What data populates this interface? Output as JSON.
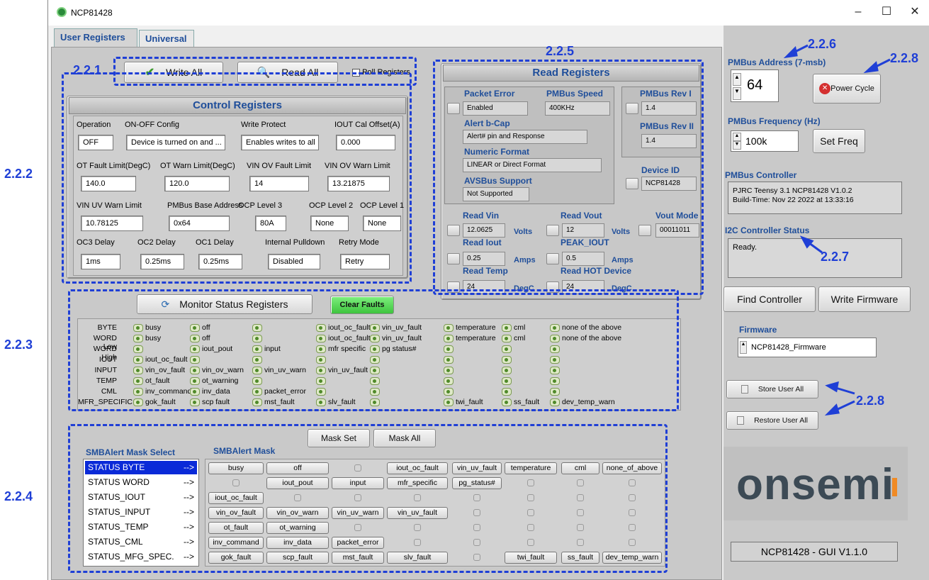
{
  "window": {
    "title": "NCP81428",
    "min": "–",
    "max": "☐",
    "close": "✕"
  },
  "tabs": [
    "User Registers",
    "Universal"
  ],
  "toolbar": {
    "write_all": "Write All",
    "read_all": "Read All",
    "poll": "Poll Registers"
  },
  "control": {
    "title": "Control Registers",
    "row1": [
      {
        "label": "Operation",
        "value": "OFF"
      },
      {
        "label": "ON-OFF Config",
        "value": "Device is turned on and ..."
      },
      {
        "label": "Write Protect",
        "value": "Enables writes to all"
      },
      {
        "label": "IOUT Cal Offset(A)",
        "value": "0.000"
      }
    ],
    "row2": [
      {
        "label": "OT Fault Limit(DegC)",
        "value": "140.0"
      },
      {
        "label": "OT Warn Limit(DegC)",
        "value": "120.0"
      },
      {
        "label": "VIN OV Fault Limit",
        "value": "14"
      },
      {
        "label": "VIN OV Warn Limit",
        "value": "13.21875"
      }
    ],
    "row3": [
      {
        "label": "VIN UV Warn Limit",
        "value": "10.78125"
      },
      {
        "label": "PMBus Base Address",
        "value": "0x64"
      },
      {
        "label": "OCP Level 3",
        "value": "80A"
      },
      {
        "label": "OCP Level 2",
        "value": "None"
      },
      {
        "label": "OCP Level 1",
        "value": "None"
      }
    ],
    "row4": [
      {
        "label": "OC3 Delay",
        "value": "1ms"
      },
      {
        "label": "OC2 Delay",
        "value": "0.25ms"
      },
      {
        "label": "OC1 Delay",
        "value": "0.25ms"
      },
      {
        "label": "Internal Pulldown",
        "value": "Disabled"
      },
      {
        "label": "Retry Mode",
        "value": "Retry"
      }
    ]
  },
  "read": {
    "title": "Read Registers",
    "packet_error_label": "Packet Error",
    "packet_error": "Enabled",
    "pmbus_speed_label": "PMBus  Speed",
    "pmbus_speed": "400KHz",
    "alert_bcap_label": "Alert b-Cap",
    "alert_bcap": "Alert# pin and Response",
    "numeric_label": "Numeric Format",
    "numeric": "LINEAR or Direct Format",
    "avsbus_label": "AVSBus Support",
    "avsbus": "Not Supported",
    "rev1_label": "PMBus Rev I",
    "rev1": "1.4",
    "rev2_label": "PMBus Rev II",
    "rev2": "1.4",
    "devid_label": "Device ID",
    "devid": "NCP81428",
    "vin_label": "Read Vin",
    "vin": "12.0625",
    "vin_unit": "Volts",
    "vout_label": "Read Vout",
    "vout": "12",
    "vout_unit": "Volts",
    "voutmode_label": "Vout Mode",
    "voutmode": "00011011",
    "iout_label": "Read Iout",
    "iout": "0.25",
    "iout_unit": "Amps",
    "peak_label": "PEAK_IOUT",
    "peak": "0.5",
    "peak_unit": "Amps",
    "temp_label": "Read Temp",
    "temp": "24",
    "temp_unit": "DegC",
    "hot_label": "Read HOT Device",
    "hot": "24",
    "hot_unit": "DegC"
  },
  "monitor": {
    "button": "Monitor Status Registers",
    "clear": "Clear Faults",
    "rows": [
      {
        "name": "BYTE",
        "cells": [
          "busy",
          "off",
          "",
          "iout_oc_fault",
          "vin_uv_fault",
          "temperature",
          "cml",
          "none of the above"
        ]
      },
      {
        "name": "WORD Low",
        "cells": [
          "busy",
          "off",
          "",
          "iout_oc_fault",
          "vin_uv_fault",
          "temperature",
          "cml",
          "none of the above"
        ]
      },
      {
        "name": "WORD High",
        "cells": [
          "",
          "iout_pout",
          "input",
          "mfr specific",
          "pg status#",
          "",
          "",
          ""
        ]
      },
      {
        "name": "IOUT",
        "cells": [
          "iout_oc_fault",
          "",
          "",
          "",
          "",
          "",
          "",
          ""
        ]
      },
      {
        "name": "INPUT",
        "cells": [
          "vin_ov_fault",
          "vin_ov_warn",
          "vin_uv_warn",
          "vin_uv_fault",
          "",
          "",
          "",
          ""
        ]
      },
      {
        "name": "TEMP",
        "cells": [
          "ot_fault",
          "ot_warning",
          "",
          "",
          "",
          "",
          "",
          ""
        ]
      },
      {
        "name": "CML",
        "cells": [
          "inv_command",
          "inv_data",
          "packet_error",
          "",
          "",
          "",
          "",
          ""
        ]
      },
      {
        "name": "MFR_SPECIFIC",
        "cells": [
          "gok_fault",
          "scp fault",
          "mst_fault",
          "slv_fault",
          "",
          "twi_fault",
          "ss_fault",
          "dev_temp_warn"
        ]
      }
    ]
  },
  "mask": {
    "mask_set": "Mask Set",
    "mask_all": "Mask All",
    "select_title": "SMBAlert Mask Select",
    "mask_title": "SMBAlert Mask",
    "select_items": [
      {
        "name": "STATUS BYTE",
        "arrow": "-->"
      },
      {
        "name": "STATUS WORD",
        "arrow": "-->"
      },
      {
        "name": "STATUS_IOUT",
        "arrow": "-->"
      },
      {
        "name": "STATUS_INPUT",
        "arrow": "-->"
      },
      {
        "name": "STATUS_TEMP",
        "arrow": "-->"
      },
      {
        "name": "STATUS_CML",
        "arrow": "-->"
      },
      {
        "name": "STATUS_MFG_SPEC.",
        "arrow": "-->"
      }
    ],
    "rows": [
      [
        "busy",
        "off",
        "",
        "iout_oc_fault",
        "vin_uv_fault",
        "temperature",
        "cml",
        "none_of_above"
      ],
      [
        "",
        "iout_pout",
        "input",
        "mfr_specific",
        "pg_status#",
        "",
        "",
        ""
      ],
      [
        "iout_oc_fault",
        "",
        "",
        "",
        "",
        "",
        "",
        ""
      ],
      [
        "vin_ov_fault",
        "vin_ov_warn",
        "vin_uv_warn",
        "vin_uv_fault",
        "",
        "",
        "",
        ""
      ],
      [
        "ot_fault",
        "ot_warning",
        "",
        "",
        "",
        "",
        "",
        ""
      ],
      [
        "inv_command",
        "inv_data",
        "packet_error",
        "",
        "",
        "",
        "",
        ""
      ],
      [
        "gok_fault",
        "scp_fault",
        "mst_fault",
        "slv_fault",
        "",
        "twi_fault",
        "ss_fault",
        "dev_temp_warn"
      ]
    ]
  },
  "right": {
    "addr_label": "PMBus Address (7-msb)",
    "addr": "64",
    "power_cycle": "Power Cycle",
    "freq_label": "PMBus Frequency (Hz)",
    "freq": "100k",
    "set_freq": "Set Freq",
    "controller_label": "PMBus Controller",
    "controller_line1": "PJRC Teensy 3.1  NCP81428 V1.0.2",
    "controller_line2": "Build-Time: Nov 22 2022 at 13:33:16",
    "i2c_label": "I2C Controller Status",
    "i2c": "Ready.",
    "find": "Find Controller",
    "write_fw": "Write Firmware",
    "fw_label": "Firmware",
    "fw": "NCP81428_Firmware",
    "store": "Store User All",
    "restore": "Restore User All",
    "logo": "onsemi",
    "version": "NCP81428 - GUI V1.1.0"
  },
  "annotations": {
    "a221": "2.2.1",
    "a222": "2.2.2",
    "a223": "2.2.3",
    "a224": "2.2.4",
    "a225": "2.2.5",
    "a226": "2.2.6",
    "a227": "2.2.7",
    "a228a": "2.2.8",
    "a228b": "2.2.8"
  },
  "colors": {
    "annotation": "#1f3fd6",
    "label_blue": "#1f4e9a",
    "clear_green": "#4cd34c",
    "select_highlight": "#0a2ad8"
  }
}
